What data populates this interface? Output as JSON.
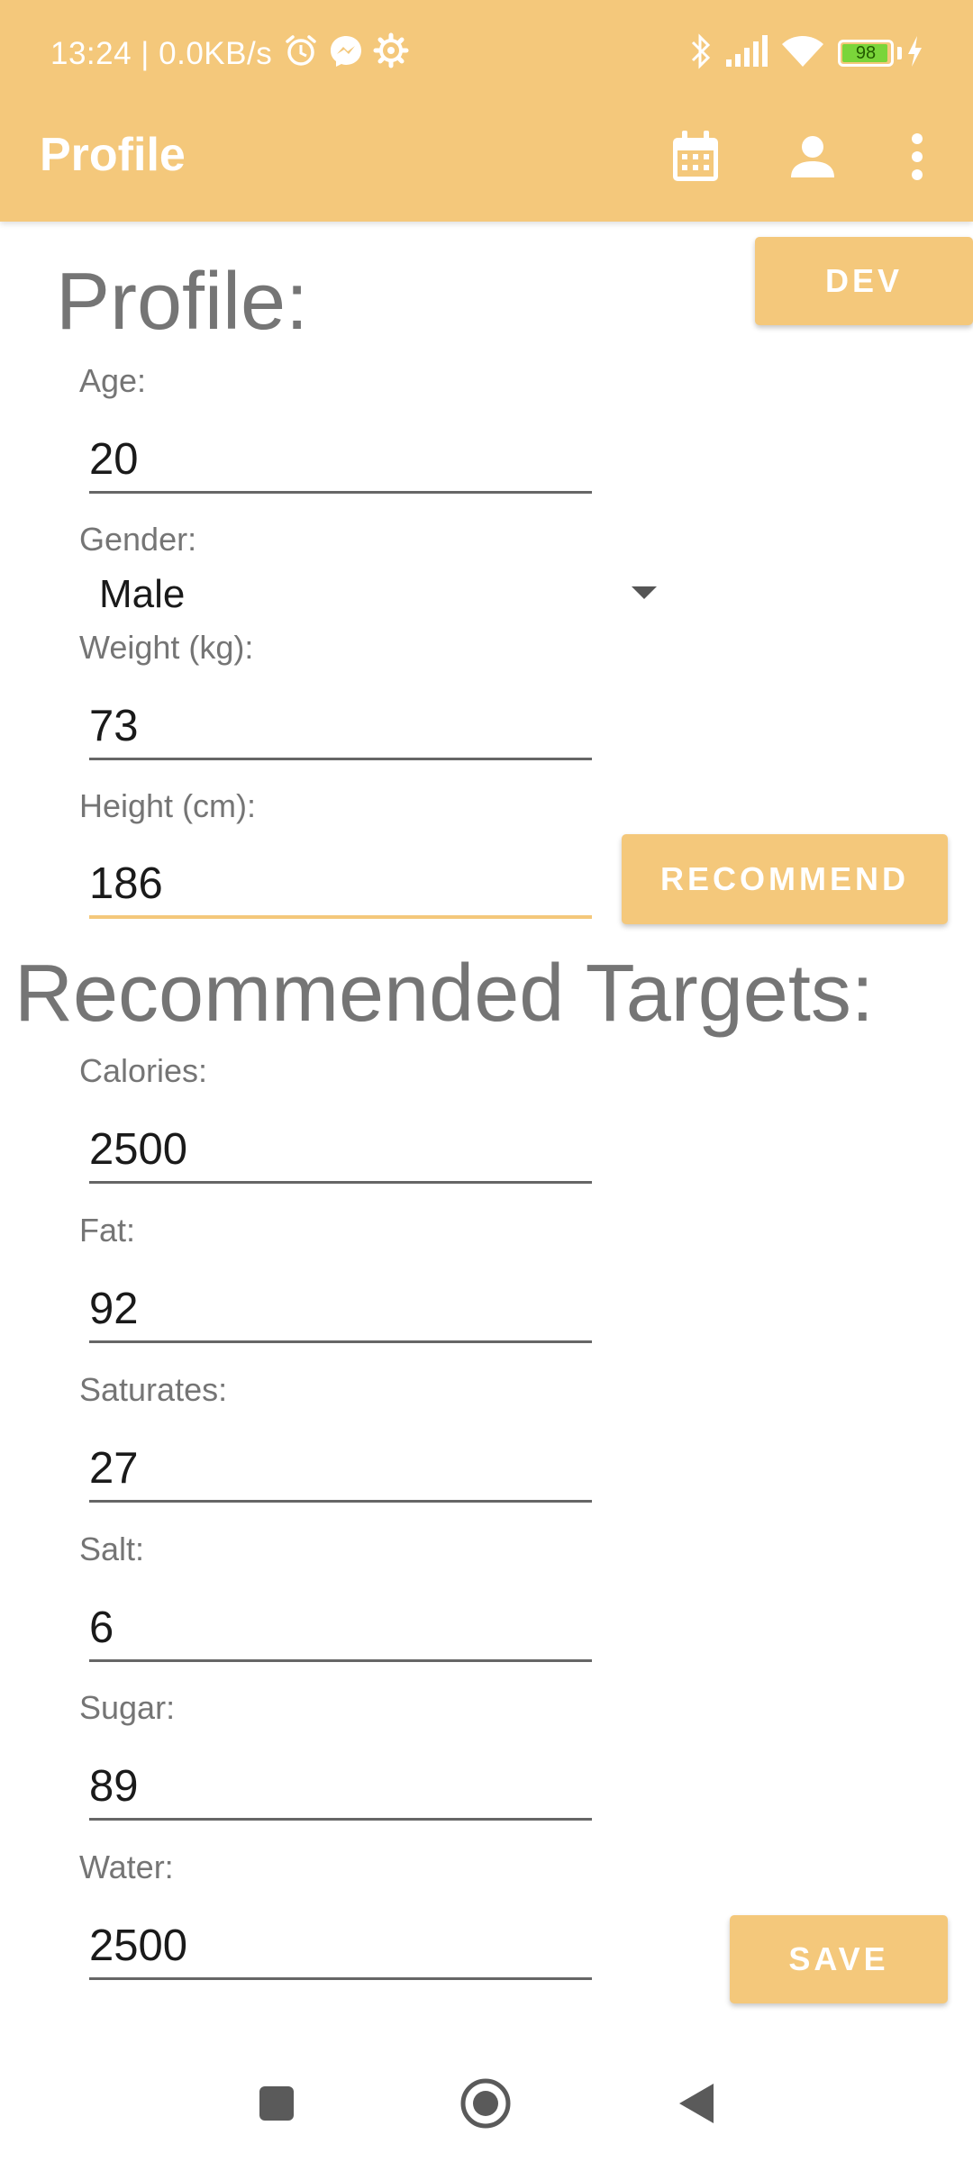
{
  "status_bar": {
    "text": "13:24 | 0.0KB/s",
    "battery": "98",
    "icons": [
      "alarm-icon",
      "messenger-icon",
      "settings-icon",
      "bluetooth-icon",
      "signal-icon",
      "wifi-icon",
      "battery-icon",
      "charging-icon"
    ]
  },
  "app_bar": {
    "title": "Profile",
    "background": "#f4c87b",
    "actions": [
      "calendar-icon",
      "person-icon",
      "more-vert-icon"
    ]
  },
  "profile": {
    "heading": "Profile:",
    "dev_button": "DEV",
    "age": {
      "label": "Age:",
      "value": "20"
    },
    "gender": {
      "label": "Gender:",
      "value": "Male"
    },
    "weight": {
      "label": "Weight (kg):",
      "value": "73"
    },
    "height": {
      "label": "Height (cm):",
      "value": "186"
    },
    "recommend_button": "RECOMMEND"
  },
  "targets": {
    "heading": "Recommended Targets:",
    "calories": {
      "label": "Calories:",
      "value": "2500"
    },
    "fat": {
      "label": "Fat:",
      "value": "92"
    },
    "saturates": {
      "label": "Saturates:",
      "value": "27"
    },
    "salt": {
      "label": "Salt:",
      "value": "6"
    },
    "sugar": {
      "label": "Sugar:",
      "value": "89"
    },
    "water": {
      "label": "Water:",
      "value": "2500"
    }
  },
  "save_button": "SAVE",
  "nav_bar": [
    "recents-icon",
    "home-icon",
    "back-icon"
  ]
}
